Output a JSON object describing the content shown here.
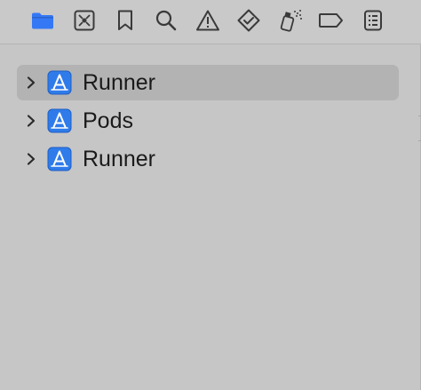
{
  "toolbar": {
    "active_color": "#3478f6",
    "icon_color": "#3a3a3a",
    "icons": [
      "folder-icon",
      "source-control-icon",
      "bookmark-icon",
      "search-icon",
      "warning-icon",
      "test-diamond-icon",
      "debug-spray-icon",
      "breakpoint-icon",
      "report-list-icon"
    ]
  },
  "navigator": {
    "items": [
      {
        "label": "Runner",
        "icon": "xcode-app-icon",
        "selected": true
      },
      {
        "label": "Pods",
        "icon": "xcode-app-icon",
        "selected": false
      },
      {
        "label": "Runner",
        "icon": "xcode-app-icon",
        "selected": false
      }
    ],
    "selection_color": "#b3b3b3",
    "app_icon_color": "#2f7bea"
  }
}
